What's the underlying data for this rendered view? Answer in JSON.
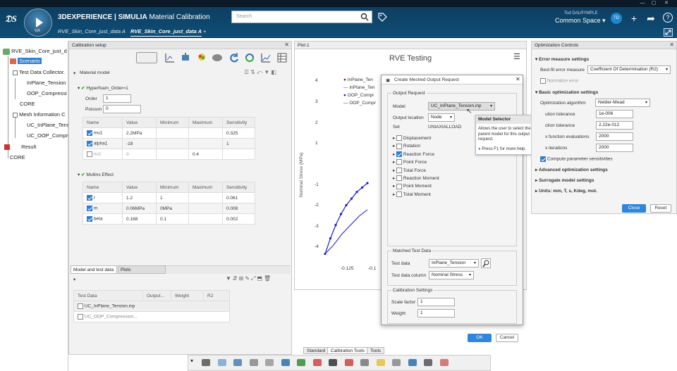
{
  "app": {
    "brand": "3DEXPERIENCE | SIMULIA",
    "title": "Material Calibration",
    "compass_version": "V,R",
    "search_placeholder": "Search",
    "user": "Tod DALRYMPLE",
    "space": "Common Space",
    "avatar_initials": "TD"
  },
  "doc_tabs": [
    "RVE_Skin_Core_just_data A",
    "RVE_Skin_Core_just_data A"
  ],
  "tree": {
    "root": "RVE_Skin_Core_just_d",
    "scenario": "Scenario",
    "test_data": "Test Data Collector.",
    "inplane": "InPlane_Tension",
    "oop": "OOP_Compressi",
    "core1": "CORE",
    "mesh_info": "Mesh Information C",
    "uc_inplane": "UC_InPlane_Tens",
    "uc_oop": "UC_OOP_Compre",
    "result": "Result",
    "core2": "CORE"
  },
  "calibration": {
    "panel_title": "Calibration setup",
    "material_model": "Material model",
    "hyperfoam": "Hyperfoam_Order=1",
    "order_label": "Order",
    "order_value": "1",
    "poisson_label": "Poisson",
    "poisson_value": "0",
    "columns": [
      "Name",
      "Value",
      "Minimum",
      "Maximum",
      "Sensitivity"
    ],
    "hyper_rows": [
      {
        "name": "mu1",
        "value": "2.2MPa",
        "min": "",
        "max": "",
        "sens": "0.325",
        "checked": true
      },
      {
        "name": "alpha1",
        "value": "-18",
        "min": "",
        "max": "",
        "sens": "1",
        "checked": true
      },
      {
        "name": "nu1",
        "value": "0",
        "min": "",
        "max": "0.4",
        "sens": "",
        "checked": false
      }
    ],
    "mullins": "Mullins Effect",
    "mullins_rows": [
      {
        "name": "r",
        "value": "1.2",
        "min": "1",
        "max": "",
        "sens": "0.061",
        "checked": true
      },
      {
        "name": "m",
        "value": "0.06MPa",
        "min": "0MPa",
        "max": "",
        "sens": "0.008",
        "checked": true
      },
      {
        "name": "beta",
        "value": "0.168",
        "min": "0.1",
        "max": "",
        "sens": "0.002",
        "checked": true
      }
    ],
    "tab_model": "Model and test data",
    "tab_plots": "Plots",
    "test_columns": [
      "Test Data",
      "Output...",
      "Weight",
      "R2"
    ],
    "test_rows": [
      "UC_InPlane_Tension.inp",
      "UC_OOP_Compression..."
    ]
  },
  "plot": {
    "tab": "Plot.1",
    "title": "RVE Testing",
    "ylabel": "Nominal Stress (MPa)",
    "legend": [
      "InPlane_Ten",
      "InPlane_Ten",
      "OOP_Compr",
      "OOP_Compr"
    ],
    "yticks": [
      "4",
      "3",
      "2",
      "1",
      "-1",
      "-2",
      "-3",
      "-4"
    ],
    "xticks": [
      "-0.125",
      "-0.1"
    ]
  },
  "chart_data": {
    "type": "line",
    "title": "RVE Testing",
    "ylabel": "Nominal Stress (MPa)",
    "ylim": [
      -4.3,
      4.3
    ],
    "series": [
      {
        "name": "OOP_Compr",
        "color": "#1a1ad6",
        "x": [
          -0.14,
          -0.135,
          -0.13,
          -0.125,
          -0.12,
          -0.115,
          -0.11,
          -0.105,
          -0.1
        ],
        "y": [
          -4.0,
          -3.3,
          -2.7,
          -2.2,
          -1.8,
          -1.5,
          -1.2,
          -1.0,
          -0.8
        ]
      },
      {
        "name": "OOP_Compr",
        "color": "#3a3ad8",
        "x": [
          -0.14,
          -0.132,
          -0.124,
          -0.116,
          -0.108,
          -0.1
        ],
        "y": [
          -4.0,
          -3.6,
          -3.1,
          -2.7,
          -2.3,
          -2.0
        ]
      }
    ]
  },
  "dialog": {
    "title": "Create Meshed Output Request",
    "output_request": "Output Request",
    "model_label": "Model",
    "model_value": "UC_InPlane_Tension.inp",
    "output_location_label": "Output location",
    "output_location_value": "Node",
    "set_label": "Set",
    "set_value": "UNIAXIALLOAD",
    "options": [
      {
        "label": "Displacement",
        "checked": false
      },
      {
        "label": "Rotation",
        "checked": false
      },
      {
        "label": "Reaction Force",
        "checked": true
      },
      {
        "label": "Point Force",
        "checked": false
      },
      {
        "label": "Total Force",
        "checked": false
      },
      {
        "label": "Reaction Moment",
        "checked": false
      },
      {
        "label": "Point Moment",
        "checked": false
      },
      {
        "label": "Total Moment",
        "checked": false
      }
    ],
    "matched_test_data": "Matched Test Data",
    "test_data_label": "Test data",
    "test_data_value": "InPlane_Tension",
    "test_col_label": "Test data column",
    "test_col_value": "Nominal Stress",
    "calibration_settings": "Calibration Settings",
    "scale_label": "Scale factor",
    "scale_value": "1",
    "weight_label": "Weight",
    "weight_value": "1",
    "ok": "OK",
    "cancel": "Cancel"
  },
  "tooltip": {
    "title": "Model Selector",
    "text": "Allows the user to select the parent model for this output request.",
    "help": "Press F1 for more help."
  },
  "optimization": {
    "title": "Optimization Controls",
    "error_measure": "Error measure settings",
    "best_fit_label": "Best-fit error measure",
    "best_fit_value": "Coefficient Of Determination (R2)",
    "normalize": "Normalize error",
    "basic": "Basic optimization settings",
    "algo_label": "Optimization algorithm",
    "algo_value": "Nelder-Mead",
    "fields": [
      {
        "label": "ution tolerance",
        "value": "1e-006"
      },
      {
        "label": "ction tolerance",
        "value": "2.22e-012"
      },
      {
        "label": "x function evaluations",
        "value": "2000"
      },
      {
        "label": "x iterations",
        "value": "2000"
      }
    ],
    "compute_sens": "Compute parameter sensitivities",
    "advanced": "Advanced optimization settings",
    "surrogate": "Surrogate model settings",
    "units": "Units: mm, T, s, Kdeg, mol.",
    "close": "Close",
    "reset": "Reset"
  },
  "bottom_tabs": [
    "Standard",
    "Calibration Tools",
    "Tools"
  ]
}
